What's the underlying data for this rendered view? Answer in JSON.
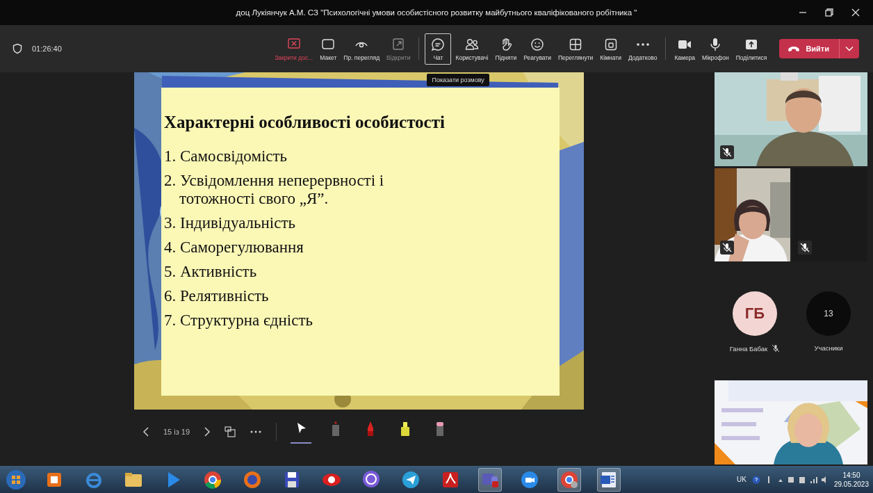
{
  "window": {
    "title": "доц Лукіянчук А.М. СЗ \"Психологічні умови особистісного розвитку майбутнього кваліфікованого робітника \""
  },
  "toolbar": {
    "timer": "01:26:40",
    "buttons": [
      {
        "label": "Закрити дос...",
        "kind": "danger",
        "disabled": false,
        "selected": false
      },
      {
        "label": "Макет",
        "kind": "normal",
        "disabled": false,
        "selected": false
      },
      {
        "label": "Пр. перегляд",
        "kind": "normal",
        "disabled": false,
        "selected": false
      },
      {
        "label": "Відкрити",
        "kind": "normal",
        "disabled": true,
        "selected": false
      },
      {
        "label": "Чат",
        "kind": "normal",
        "disabled": false,
        "selected": true
      },
      {
        "label": "Користувачі",
        "kind": "normal",
        "disabled": false,
        "selected": false
      },
      {
        "label": "Підняти",
        "kind": "normal",
        "disabled": false,
        "selected": false
      },
      {
        "label": "Реагувати",
        "kind": "normal",
        "disabled": false,
        "selected": false
      },
      {
        "label": "Переглянути",
        "kind": "normal",
        "disabled": false,
        "selected": false
      },
      {
        "label": "Кімнати",
        "kind": "normal",
        "disabled": false,
        "selected": false
      },
      {
        "label": "Додатково",
        "kind": "normal",
        "disabled": false,
        "selected": false
      },
      {
        "label": "Камера",
        "kind": "normal",
        "disabled": false,
        "selected": false
      },
      {
        "label": "Мікрофон",
        "kind": "normal",
        "disabled": false,
        "selected": false
      },
      {
        "label": "Поділитися",
        "kind": "normal",
        "disabled": false,
        "selected": false
      }
    ],
    "leave_button": "Вийти",
    "tooltip": "Показати розмову"
  },
  "slide": {
    "title": "Характерні особливості особистості",
    "items": [
      "1. Самосвідомість",
      "2. Усвідомлення неперервності і тотожності свого „Я”.",
      "3. Індивідуальність",
      "4. Саморегулювання",
      "5. Активність",
      "6. Релятивність",
      "7. Структурна єдність"
    ]
  },
  "slide_controls": {
    "counter": "15 із 19",
    "tools": [
      {
        "selected": true
      },
      {
        "selected": false
      },
      {
        "selected": false
      },
      {
        "selected": false
      },
      {
        "selected": false
      }
    ]
  },
  "participants": {
    "tiles": [
      {
        "kind": "video",
        "muted": true
      },
      {
        "kind": "video",
        "muted": true
      },
      {
        "kind": "empty",
        "muted": true
      }
    ],
    "avatar": {
      "initials": "ГБ",
      "name": "Ганна Бабак",
      "muted": true
    },
    "count": "13",
    "count_label": "Учасники"
  },
  "taskbar": {
    "apps": [
      {
        "running": false
      },
      {
        "running": false
      },
      {
        "running": false
      },
      {
        "running": false
      },
      {
        "running": false
      },
      {
        "running": false
      },
      {
        "running": false
      },
      {
        "running": false
      },
      {
        "running": false
      },
      {
        "running": false
      },
      {
        "running": false
      },
      {
        "running": true
      },
      {
        "running": false
      },
      {
        "running": true
      },
      {
        "running": true
      }
    ],
    "language": "UK",
    "time": "14:50",
    "date": "29.05.2023"
  }
}
